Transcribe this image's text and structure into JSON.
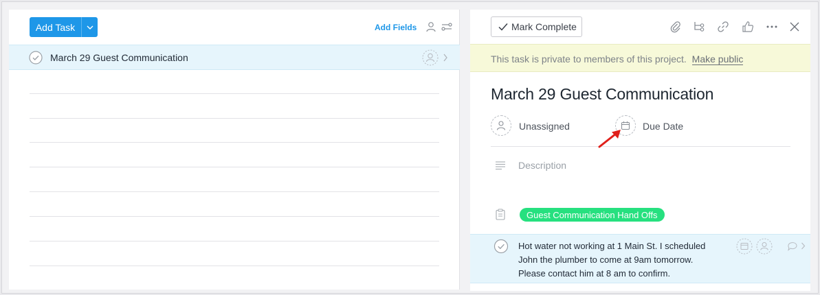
{
  "left_pane": {
    "toolbar": {
      "add_task_label": "Add Task",
      "add_fields_label": "Add Fields"
    },
    "tasks": [
      {
        "name": "March 29 Guest Communication"
      }
    ]
  },
  "right_pane": {
    "toolbar": {
      "mark_complete_label": "Mark Complete"
    },
    "private_notice": {
      "text": "This task is private to members of this project.",
      "link": "Make public"
    },
    "task": {
      "title": "March 29 Guest Communication",
      "assignee_label": "Unassigned",
      "due_date_label": "Due Date",
      "description_placeholder": "Description",
      "project_tag": "Guest Communication Hand Offs",
      "subtask_lines": [
        "Hot water not working at 1 Main St. I scheduled",
        "John the plumber to come at 9am tomorrow.",
        "Please contact him at 8 am to confirm."
      ]
    }
  },
  "colors": {
    "accent": "#1e97e8",
    "selected_row": "#e6f5fc",
    "private_bar": "#f7f9d9",
    "tag_green": "#26e07f",
    "annotation_arrow": "#e0201b"
  }
}
